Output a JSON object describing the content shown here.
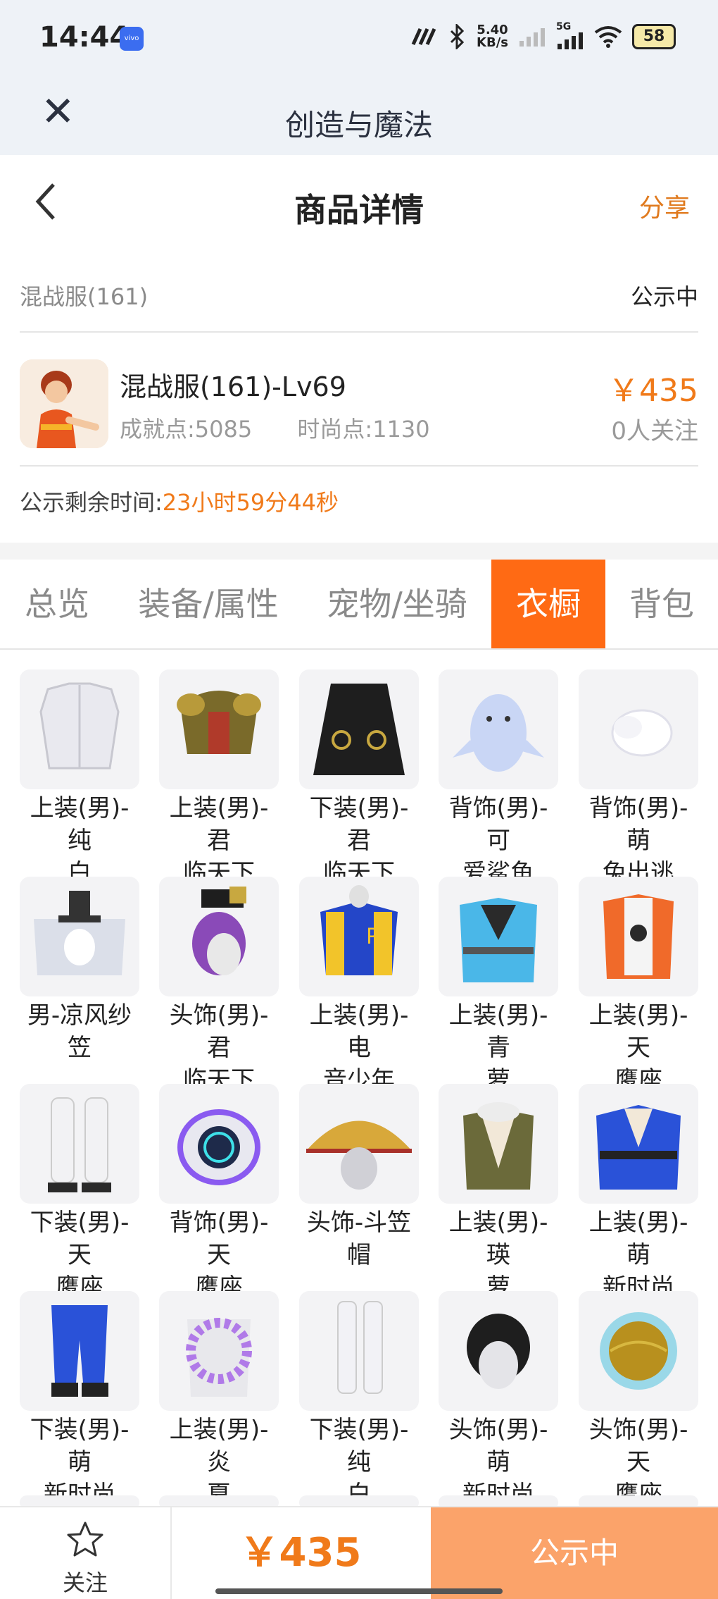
{
  "status_bar": {
    "time": "14:44",
    "vivo_label": "vivo",
    "net_speed": "5.40",
    "net_unit": "KB/s",
    "network_type": "5G",
    "battery": "58"
  },
  "app_bar": {
    "title": "创造与魔法"
  },
  "nav": {
    "title": "商品详情",
    "share_label": "分享"
  },
  "server": {
    "name": "混战服(161)",
    "status": "公示中"
  },
  "product": {
    "name": "混战服(161)-Lv69",
    "achievement": "成就点:5085",
    "fashion": "时尚点:1130",
    "price": "￥435",
    "followers": "0人关注"
  },
  "timer": {
    "label": "公示剩余时间:",
    "value": "23小时59分44秒"
  },
  "tabs": [
    {
      "label": "总览"
    },
    {
      "label": "装备/属性"
    },
    {
      "label": "宠物/坐骑"
    },
    {
      "label": "衣橱"
    },
    {
      "label": "背包"
    }
  ],
  "active_tab": "衣橱",
  "wardrobe": [
    {
      "line1": "上装(男)-纯",
      "line2": "白",
      "icon": "white-coat-icon"
    },
    {
      "line1": "上装(男)-君",
      "line2": "临天下",
      "icon": "gold-armor-icon"
    },
    {
      "line1": "下装(男)-君",
      "line2": "临天下",
      "icon": "black-skirt-icon"
    },
    {
      "line1": "背饰(男)-可",
      "line2": "爱鲨鱼",
      "icon": "shark-backpack-icon"
    },
    {
      "line1": "背饰(男)-萌",
      "line2": "兔出逃",
      "icon": "white-fluff-icon"
    },
    {
      "line1": "男-凉风纱",
      "line2": "笠",
      "icon": "veil-hat-icon"
    },
    {
      "line1": "头饰(男)-君",
      "line2": "临天下",
      "icon": "purple-hair-icon"
    },
    {
      "line1": "上装(男)-电",
      "line2": "音少年",
      "icon": "varsity-jacket-icon"
    },
    {
      "line1": "上装(男)-青",
      "line2": "萝",
      "icon": "blue-robe-icon"
    },
    {
      "line1": "上装(男)-天",
      "line2": "鹰座",
      "icon": "orange-jacket-icon"
    },
    {
      "line1": "下装(男)-天",
      "line2": "鹰座",
      "icon": "white-pants-icon"
    },
    {
      "line1": "背饰(男)-天",
      "line2": "鹰座",
      "icon": "tech-backpack-icon"
    },
    {
      "line1": "头饰-斗笠",
      "line2": "帽",
      "icon": "bamboo-hat-icon"
    },
    {
      "line1": "上装(男)-瑛",
      "line2": "萝",
      "icon": "scarf-vest-icon"
    },
    {
      "line1": "上装(男)-萌",
      "line2": "新时尚",
      "icon": "blue-kimono-icon"
    },
    {
      "line1": "下装(男)-萌",
      "line2": "新时尚",
      "icon": "blue-pants-icon"
    },
    {
      "line1": "上装(男)-炎",
      "line2": "夏",
      "icon": "flower-lei-icon"
    },
    {
      "line1": "下装(男)-纯",
      "line2": "白",
      "icon": "white-legs-icon"
    },
    {
      "line1": "头饰(男)-萌",
      "line2": "新时尚",
      "icon": "black-hair-icon"
    },
    {
      "line1": "头饰(男)-天",
      "line2": "鹰座",
      "icon": "gold-helmet-icon"
    }
  ],
  "bottom": {
    "follow_label": "关注",
    "price": "￥435",
    "action_label": "公示中"
  },
  "colors": {
    "accent": "#ff6a14",
    "price": "#f07a1a",
    "action": "#fba36a"
  }
}
